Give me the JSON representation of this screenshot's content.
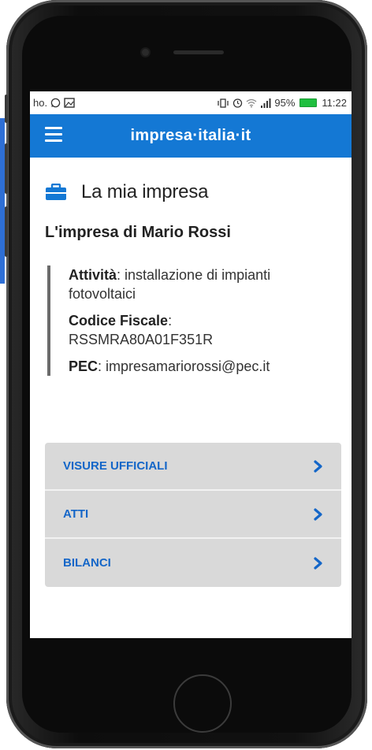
{
  "status_bar": {
    "left_text": "ho.",
    "left_icons": [
      "whatsapp-icon",
      "image-icon"
    ],
    "right_icons": [
      "vibrate-icon",
      "alarm-icon",
      "wifi-icon",
      "signal-icon"
    ],
    "battery_level": "95%",
    "time": "11:22"
  },
  "appbar": {
    "menu_icon": "hamburger-menu-icon",
    "brand": "impresa·italia·it",
    "color": "#1478d4"
  },
  "section": {
    "icon": "briefcase-icon",
    "title": "La mia impresa"
  },
  "company": {
    "name": "L'impresa di Mario Rossi",
    "activity_label": "Attività",
    "activity_value": ": installazione di impianti fotovoltaici",
    "tax_code_label": "Codice Fiscale",
    "tax_code_colon": ":",
    "tax_code_value": "RSSMRA80A01F351R",
    "pec_label": "PEC",
    "pec_value": ": impresamariorossi@pec.it"
  },
  "menu": {
    "items": [
      {
        "label": "VISURE UFFICIALI"
      },
      {
        "label": "ATTI"
      },
      {
        "label": "BILANCI"
      }
    ],
    "chevron_icon": "chevron-right-icon",
    "link_color": "#1466c8"
  }
}
